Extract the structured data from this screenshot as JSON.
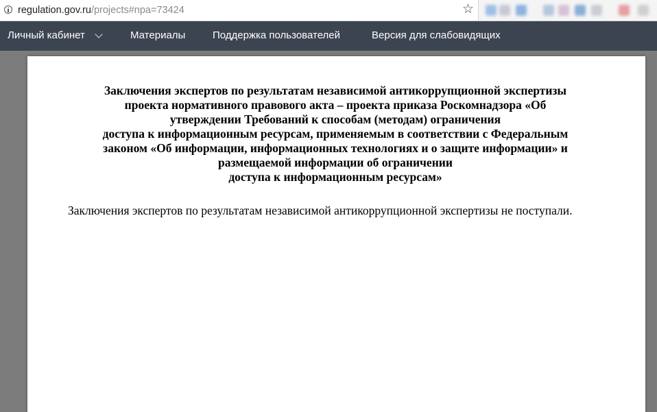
{
  "browser": {
    "url_host": "regulation.gov.ru",
    "url_path": "/projects#npa=73424",
    "icons": {
      "info": "info-icon",
      "bookmark": "star-icon"
    },
    "extension_colors": [
      "#9fc0e6",
      "#c9c9d6",
      "#8fb3e0",
      "#b6c6de",
      "#d7c1d9",
      "#8ab0d6",
      "#c9cdd4",
      "#e5a0a6",
      "#cfcfcf"
    ]
  },
  "nav": {
    "items": [
      {
        "label": "Личный кабинет",
        "has_dropdown": true
      },
      {
        "label": "Материалы"
      },
      {
        "label": "Поддержка пользователей"
      },
      {
        "label": "Версия для слабовидящих"
      }
    ],
    "background": "#3c4451",
    "dropdown_icon": "chevron-down-icon"
  },
  "document": {
    "title_lines": [
      "Заключения экспертов по результатам независимой антикоррупционной экспертизы",
      "проекта нормативного правового акта – проекта приказа Роскомнадзора «Об",
      "утверждении Требований к способам (методам) ограничения",
      "доступа к информационным ресурсам, применяемым в соответствии с Федеральным",
      "законом «Об информации, информационных технологиях и о защите информации» и",
      "размещаемой информации об ограничении",
      "доступа к информационным ресурсам»"
    ],
    "body": "Заключения экспертов по результатам независимой антикоррупционной экспертизы не поступали."
  }
}
